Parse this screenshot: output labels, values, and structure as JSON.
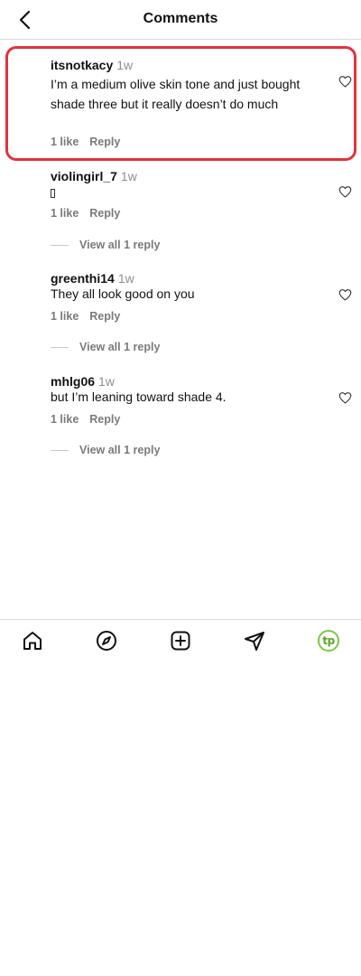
{
  "header": {
    "title": "Comments"
  },
  "comments": [
    {
      "username": "itsnotkacy",
      "time": "1w",
      "text": "I’m a medium olive skin tone and just bought shade three but it really doesn’t do much",
      "likes": "1 like",
      "reply_label": "Reply",
      "view_replies": ""
    },
    {
      "username": "violingirl_7",
      "time": "1w",
      "text": "",
      "likes": "1 like",
      "reply_label": "Reply",
      "view_replies": "View all 1 reply"
    },
    {
      "username": "greenthi14",
      "time": "1w",
      "text": "They all look good on you",
      "likes": "1 like",
      "reply_label": "Reply",
      "view_replies": "View all 1 reply"
    },
    {
      "username": "mhlg06",
      "time": "1w",
      "text": "but I’m leaning toward shade 4.",
      "likes": "1 like",
      "reply_label": "Reply",
      "view_replies": "View all 1 reply"
    }
  ],
  "bottom_nav": {
    "items": [
      {
        "icon": "home-icon"
      },
      {
        "icon": "explore-compass-icon"
      },
      {
        "icon": "create-post-icon"
      },
      {
        "icon": "send-message-icon"
      },
      {
        "icon": "profile-avatar",
        "label": "tp"
      }
    ]
  },
  "colors": {
    "highlight": "#e0343d",
    "muted_text": "#7a7a7a",
    "avatar_green": "#7ac943"
  }
}
